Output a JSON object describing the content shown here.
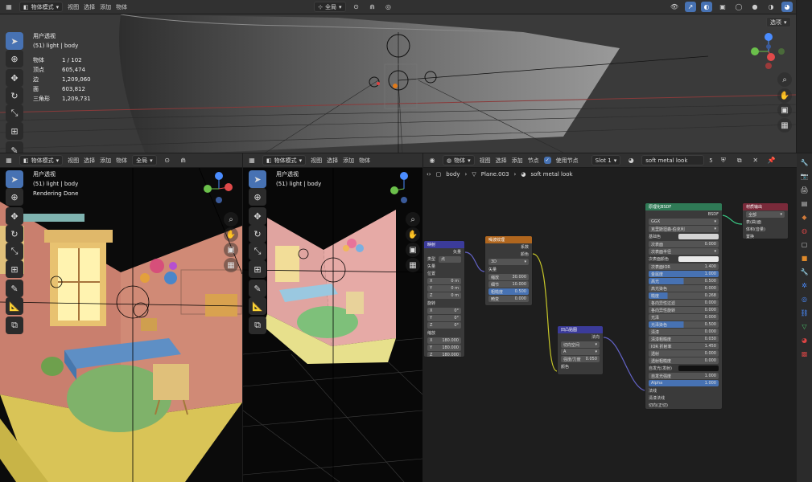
{
  "top_viewport": {
    "mode": "物体模式",
    "menus": [
      "视图",
      "选择",
      "添加",
      "物体"
    ],
    "transform": "全局",
    "options": "选项",
    "view_name": "用户透视",
    "collection": "(51) light | body",
    "stats": [
      {
        "k": "物体",
        "v": "1 / 102"
      },
      {
        "k": "顶点",
        "v": "605,474"
      },
      {
        "k": "边",
        "v": "1,209,060"
      },
      {
        "k": "面",
        "v": "603,812"
      },
      {
        "k": "三角形",
        "v": "1,209,731"
      }
    ]
  },
  "left_viewport": {
    "mode": "物体模式",
    "menus": [
      "视图",
      "选择",
      "添加",
      "物体"
    ],
    "transform": "全局",
    "view_name": "用户透视",
    "collection": "(51) light | body",
    "status": "Rendering Done"
  },
  "mid_viewport": {
    "mode": "物体模式",
    "menus": [
      "视图",
      "选择",
      "添加",
      "物体"
    ],
    "view_name": "用户透视",
    "collection": "(51) light | body"
  },
  "node_editor": {
    "object": "物体",
    "menus": [
      "视图",
      "选择",
      "添加",
      "节点"
    ],
    "use_nodes": "使用节点",
    "slot": "Slot 1",
    "material": "soft metal look",
    "users": "5",
    "breadcrumb": [
      "body",
      "Plane.003",
      "soft metal look"
    ],
    "nodes": {
      "mapping": {
        "title": "映射",
        "out": "矢量",
        "type_label": "类型",
        "type_value": "点",
        "vec": "矢量",
        "loc": "位置",
        "loc_vals": [
          {
            "a": "X",
            "v": "0 m"
          },
          {
            "a": "Y",
            "v": "0 m"
          },
          {
            "a": "Z",
            "v": "0 m"
          }
        ],
        "rot": "旋转",
        "rot_vals": [
          {
            "a": "X",
            "v": "0°"
          },
          {
            "a": "Y",
            "v": "0°"
          },
          {
            "a": "Z",
            "v": "0°"
          }
        ],
        "scale": "缩放",
        "scale_vals": [
          {
            "a": "X",
            "v": "180.000"
          },
          {
            "a": "Y",
            "v": "180.000"
          },
          {
            "a": "Z",
            "v": "180.000"
          }
        ]
      },
      "noise": {
        "title": "噪波纹理",
        "out1": "系数",
        "out2": "颜色",
        "dim": "3D",
        "vec": "矢量",
        "rows": [
          {
            "k": "缩放",
            "v": "30.000"
          },
          {
            "k": "细节",
            "v": "10.000"
          },
          {
            "k": "粗糙度",
            "v": "0.500"
          },
          {
            "k": "畸变",
            "v": "0.000"
          }
        ]
      },
      "bump": {
        "title": "凹凸贴图",
        "out": "法向",
        "space": "切向空间",
        "channel": "A",
        "strength_k": "强度/力度",
        "strength_v": "0.050",
        "in": "颜色"
      },
      "bsdf": {
        "title": "原理化BSDF",
        "out": "BSDF",
        "dist": "GGX",
        "sss": "克里斯坦森-伯克利",
        "rows": [
          {
            "k": "基础色",
            "v": ""
          },
          {
            "k": "次表面",
            "v": "0.000"
          },
          {
            "k": "次表面半径",
            "v": ""
          },
          {
            "k": "次表面颜色",
            "v": ""
          },
          {
            "k": "次表面IOR",
            "v": "1.400"
          },
          {
            "k": "金属度",
            "v": "1.000"
          },
          {
            "k": "高光",
            "v": "0.500"
          },
          {
            "k": "高光染色",
            "v": "0.000"
          },
          {
            "k": "糙度",
            "v": "0.268"
          },
          {
            "k": "各向异性过滤",
            "v": "0.000"
          },
          {
            "k": "各向异性旋转",
            "v": "0.000"
          },
          {
            "k": "光泽",
            "v": "0.000"
          },
          {
            "k": "光泽染色",
            "v": "0.500"
          },
          {
            "k": "清漆",
            "v": "0.000"
          },
          {
            "k": "清漆粗糙度",
            "v": "0.030"
          },
          {
            "k": "IOR 折射率",
            "v": "1.450"
          },
          {
            "k": "透射",
            "v": "0.000"
          },
          {
            "k": "透射粗糙度",
            "v": "0.000"
          },
          {
            "k": "自发光(发射)",
            "v": ""
          },
          {
            "k": "自发光强度",
            "v": "1.000"
          },
          {
            "k": "Alpha",
            "v": "1.000"
          },
          {
            "k": "法线",
            "v": ""
          },
          {
            "k": "清漆法线",
            "v": ""
          },
          {
            "k": "切向(正切)",
            "v": ""
          }
        ]
      },
      "output": {
        "title": "材质输出",
        "target": "全部",
        "in1": "表(曲)面",
        "in2": "体积(音量)",
        "in3": "置换"
      }
    }
  },
  "colors": {
    "accent": "#4772b3",
    "header": "#303030",
    "panel": "#2b2b2b"
  }
}
